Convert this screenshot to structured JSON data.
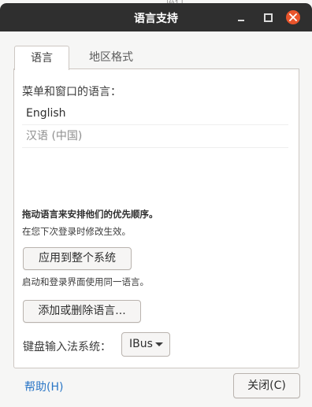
{
  "background": {
    "ghost_text": "运行"
  },
  "window": {
    "title": "语言支持",
    "controls": {
      "minimize": "minimize",
      "maximize": "maximize",
      "close": "close"
    }
  },
  "tabs": [
    {
      "label": "语言",
      "active": true
    },
    {
      "label": "地区格式",
      "active": false
    }
  ],
  "language_section": {
    "label": "菜单和窗口的语言：",
    "languages": [
      "English",
      "汉语 (中国)"
    ],
    "hint_bold": "拖动语言来安排他们的优先顺序。",
    "hint": "在您下次登录时修改生效。",
    "apply_button": "应用到整个系统",
    "apply_hint": "启动和登录界面使用同一语言。",
    "add_remove_button": "添加或删除语言..."
  },
  "keyboard": {
    "label": "键盘输入法系统：",
    "selected": "IBus"
  },
  "footer": {
    "help_label": "帮助(H)",
    "close_label": "关闭(C)"
  },
  "colors": {
    "titlebar": "#2f2f2f",
    "close_button": "#e9542b",
    "link": "#2a76c6",
    "desktop": "#5a2a49"
  }
}
